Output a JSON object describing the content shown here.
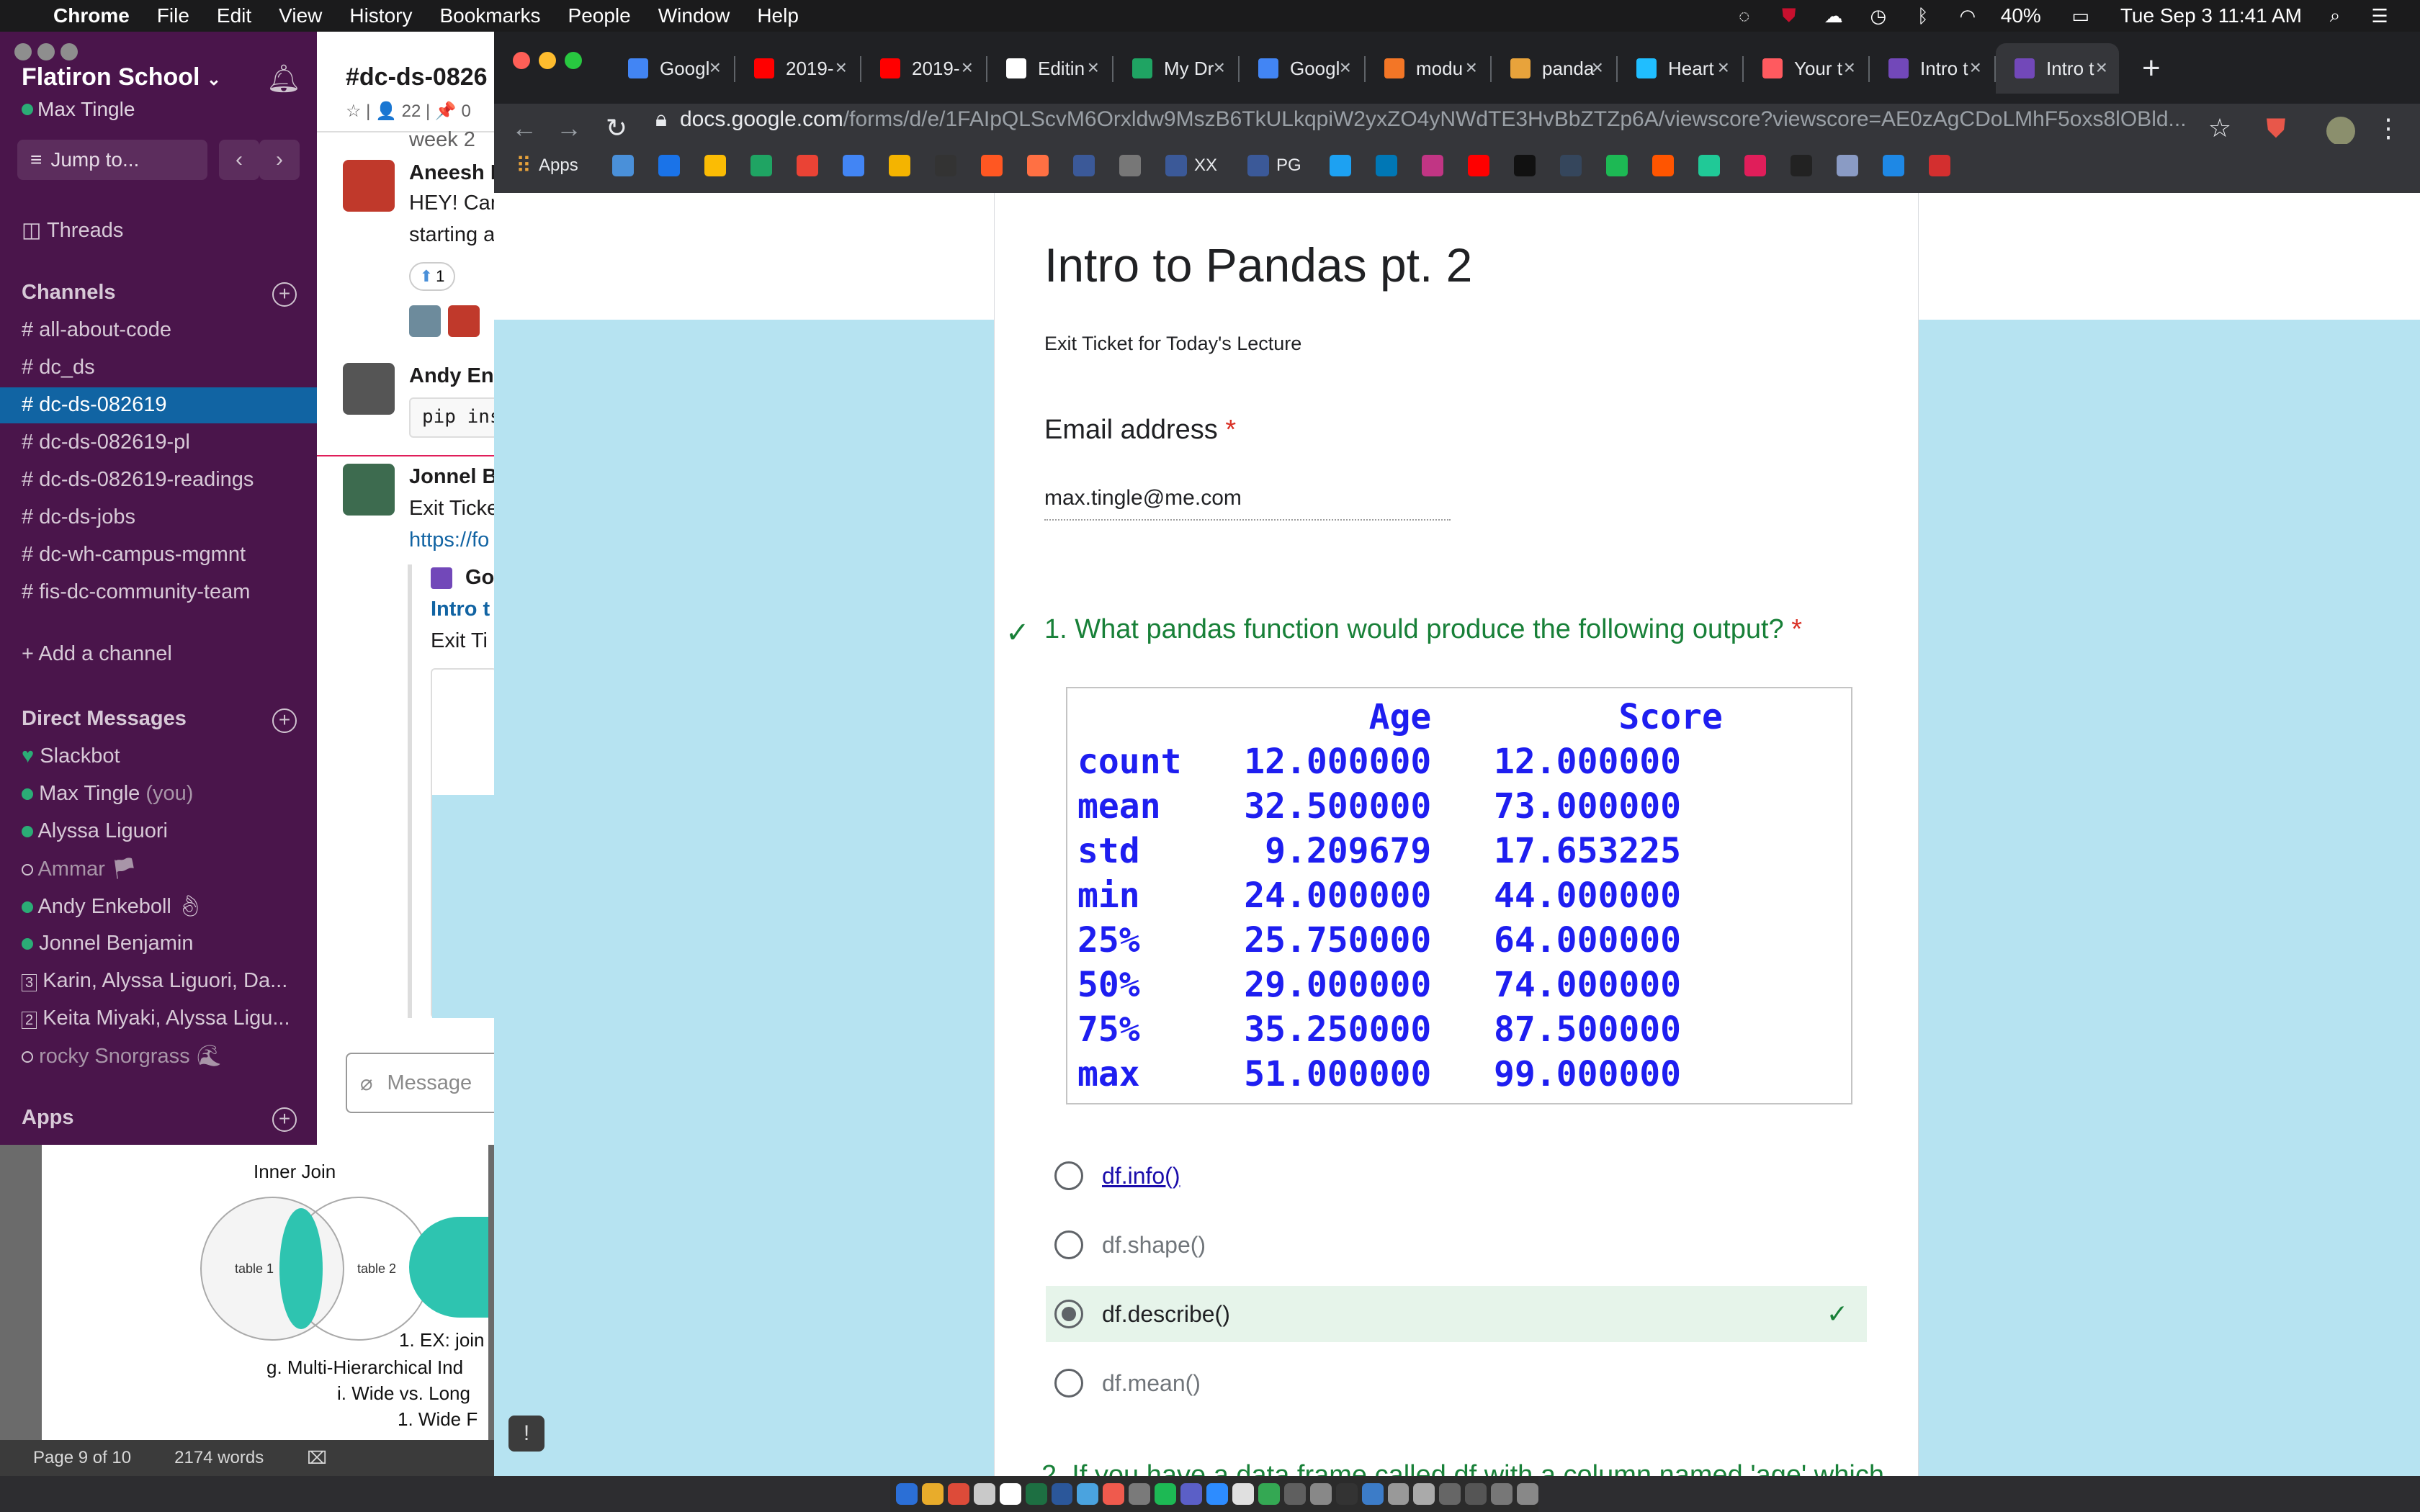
{
  "menubar": {
    "app": "Chrome",
    "items": [
      "File",
      "Edit",
      "View",
      "History",
      "Bookmarks",
      "People",
      "Window",
      "Help"
    ],
    "battery": "40%",
    "datetime": "Tue Sep 3  11:41 AM"
  },
  "word": {
    "venn_title": "Inner Join",
    "venn_left": "table 1",
    "venn_right": "table 2",
    "lines": [
      "1.   EX: join",
      "g.    Multi-Hierarchical Ind",
      "i.   Wide vs. Long",
      "1.   Wide F"
    ],
    "status_page": "Page 9 of 10",
    "status_words": "2174 words"
  },
  "slack": {
    "workspace": "Flatiron School",
    "user": "Max Tingle",
    "jump_placeholder": "Jump to...",
    "threads": "Threads",
    "channels_header": "Channels",
    "channels": [
      "all-about-code",
      "dc_ds",
      "dc-ds-082619",
      "dc-ds-082619-pl",
      "dc-ds-082619-readings",
      "dc-ds-jobs",
      "dc-wh-campus-mgmnt",
      "fis-dc-community-team"
    ],
    "add_channel": "Add a channel",
    "dm_header": "Direct Messages",
    "dms": [
      "Slackbot",
      "Max Tingle",
      "Alyssa Liguori",
      "Ammar",
      "Andy Enkeboll",
      "Jonnel Benjamin",
      "Karin, Alyssa Liguori, Da...",
      "Keita Miyaki, Alyssa Ligu...",
      "rocky Snorgrass"
    ],
    "you_suffix": "(you)",
    "group_counts": [
      "3",
      "2"
    ],
    "apps_header": "Apps",
    "channel_title": "#dc-ds-0826",
    "channel_meta": "☆ | 👤 22 | 📌 0",
    "msg1_partial": "week 2",
    "msg1_name": "Aneesh I",
    "msg1_text1": "HEY! Can",
    "msg1_text2": "starting a",
    "msg1_reaction": "1",
    "msg2_name": "Andy Enl",
    "msg2_code": "pip ins",
    "msg3_name": "Jonnel B",
    "msg3_text": "Exit Ticke",
    "msg3_link": "https://fo",
    "unfurl_title": "Go",
    "unfurl_link": "Intro t",
    "unfurl_desc": "Exit Ti",
    "composer_placeholder": "Message"
  },
  "chrome": {
    "tabs": [
      {
        "title": "Googl",
        "icon": "google-calendar-icon",
        "color": "#4285f4"
      },
      {
        "title": "2019-",
        "icon": "youtube-icon",
        "color": "#ff0000"
      },
      {
        "title": "2019-",
        "icon": "youtube-icon",
        "color": "#ff0000"
      },
      {
        "title": "Editin",
        "icon": "medium-icon",
        "color": "#ffffff"
      },
      {
        "title": "My Dr",
        "icon": "google-drive-icon",
        "color": "#1fa463"
      },
      {
        "title": "Googl",
        "icon": "google-contacts-icon",
        "color": "#4285f4"
      },
      {
        "title": "modu",
        "icon": "jupyter-icon",
        "color": "#f37626"
      },
      {
        "title": "panda",
        "icon": "book-icon",
        "color": "#e8a33b"
      },
      {
        "title": "Heart",
        "icon": "kaggle-icon",
        "color": "#20beff"
      },
      {
        "title": "Your t",
        "icon": "airbnb-icon",
        "color": "#ff5a5f"
      },
      {
        "title": "Intro t",
        "icon": "google-forms-icon",
        "color": "#7248b9"
      },
      {
        "title": "Intro t",
        "icon": "google-forms-icon",
        "color": "#7248b9"
      }
    ],
    "url_host": "docs.google.com",
    "url_path": "/forms/d/e/1FAIpQLScvM6Orxldw9MszB6TkULkqpiW2yxZO4yNWdTE3HvBbZTZp6A/viewscore?viewscore=AE0zAgCDoLMhF5oxs8lOBld...",
    "bookmarks": [
      {
        "label": "Apps",
        "icon": "apps-grid-icon"
      },
      {
        "label": "XX",
        "icon": "facebook-icon"
      },
      {
        "label": "PG",
        "icon": "facebook-icon"
      }
    ]
  },
  "form": {
    "title": "Intro to Pandas pt. 2",
    "description": "Exit Ticket for Today's Lecture",
    "email_label": "Email address",
    "required_mark": "*",
    "email_value": "max.tingle@me.com",
    "question": "1. What pandas function would produce the following output?",
    "table": {
      "header": "              Age         Score",
      "rows": [
        "count   12.000000   12.000000",
        "mean    32.500000   73.000000",
        "std      9.209679   17.653225",
        "min     24.000000   44.000000",
        "25%     25.750000   64.000000",
        "50%     29.000000   74.000000",
        "75%     35.250000   87.500000",
        "max     51.000000   99.000000"
      ]
    },
    "options": [
      "df.info()",
      "df.shape()",
      "df.describe()",
      "df.mean()"
    ],
    "selected_option": "df.describe()",
    "correct_color": "#188038",
    "next_question_partial": "2. If you have a data frame called df with a column named 'age' which..."
  }
}
